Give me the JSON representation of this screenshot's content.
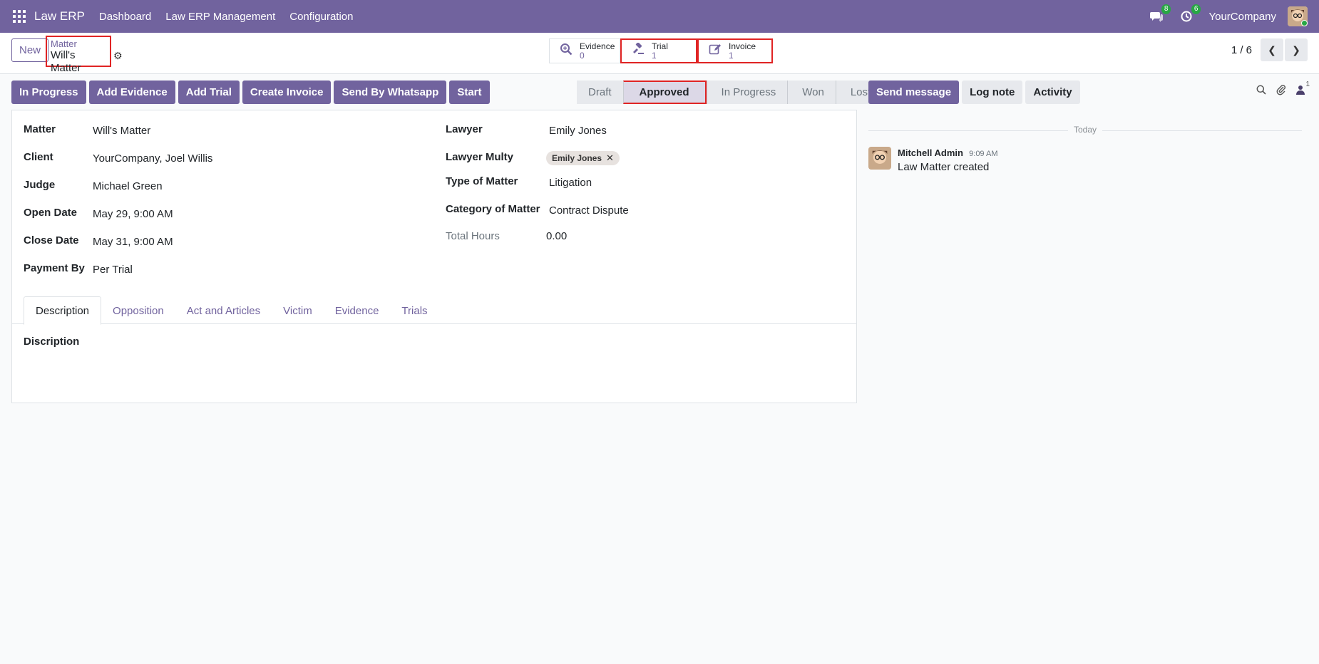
{
  "navbar": {
    "brand": "Law ERP",
    "menu": [
      "Dashboard",
      "Law ERP Management",
      "Configuration"
    ],
    "messages_count": "8",
    "activities_count": "6",
    "company": "YourCompany"
  },
  "control_panel": {
    "new_label": "New",
    "breadcrumb_parent": "Matter",
    "breadcrumb_current": "Will's Matter",
    "smart_buttons": [
      {
        "label": "Evidence",
        "value": "0",
        "icon": "magnify-icon"
      },
      {
        "label": "Trial",
        "value": "1",
        "icon": "gavel-icon"
      },
      {
        "label": "Invoice",
        "value": "1",
        "icon": "edit-icon"
      }
    ],
    "pager": "1 / 6"
  },
  "actions": [
    "In Progress",
    "Add Evidence",
    "Add Trial",
    "Create Invoice",
    "Send By Whatsapp",
    "Start"
  ],
  "statusbar": {
    "stages": [
      "Draft",
      "Approved",
      "In Progress",
      "Won",
      "Lost"
    ],
    "current": "Approved"
  },
  "chatter": {
    "send_message": "Send message",
    "log_note": "Log note",
    "activity": "Activity",
    "followers_count": "1",
    "date_separator": "Today",
    "message": {
      "author": "Mitchell Admin",
      "time": "9:09 AM",
      "body": "Law Matter created"
    }
  },
  "form": {
    "left": [
      {
        "label": "Matter",
        "value": "Will's Matter"
      },
      {
        "label": "Client",
        "value": "YourCompany, Joel Willis"
      },
      {
        "label": "Judge",
        "value": "Michael Green"
      },
      {
        "label": "Open Date",
        "value": "May 29, 9:00 AM"
      },
      {
        "label": "Close Date",
        "value": "May 31, 9:00 AM"
      },
      {
        "label": "Payment By",
        "value": "Per Trial"
      }
    ],
    "right": {
      "lawyer_label": "Lawyer",
      "lawyer_value": "Emily Jones",
      "lawyer_multy_label": "Lawyer Multy",
      "lawyer_multy_tag": "Emily Jones",
      "type_label": "Type of Matter",
      "type_value": "Litigation",
      "category_label": "Category of Matter",
      "category_value": "Contract Dispute",
      "hours_label": "Total Hours",
      "hours_value": "0.00"
    },
    "tabs": [
      "Description",
      "Opposition",
      "Act and Articles",
      "Victim",
      "Evidence",
      "Trials"
    ],
    "active_tab": "Description",
    "tab_field_label": "Discription"
  },
  "colors": {
    "brand": "#71639e",
    "highlight": "#e02424"
  }
}
